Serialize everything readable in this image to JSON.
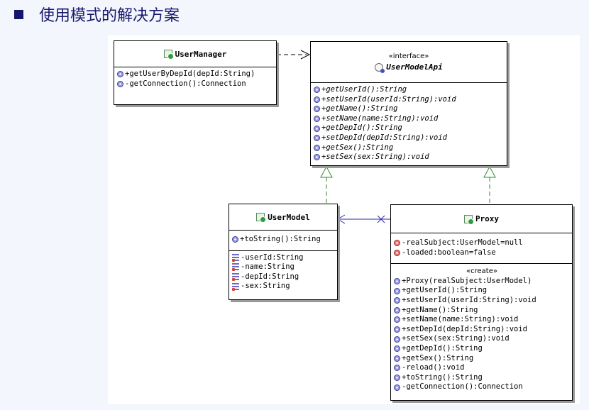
{
  "slide": {
    "title": "使用模式的解决方案"
  },
  "classes": {
    "user_manager": {
      "name": "UserManager",
      "methods": [
        {
          "vis": "pub",
          "text": "+getUserByDepId(depId:String)"
        },
        {
          "vis": "pub",
          "text": "-getConnection():Connection"
        }
      ]
    },
    "user_model_api": {
      "stereotype": "«interface»",
      "name": "UserModelApi",
      "methods": [
        {
          "vis": "pub",
          "text": "+getUserId():String"
        },
        {
          "vis": "pub",
          "text": "+setUserId(userId:String):void"
        },
        {
          "vis": "pub",
          "text": "+getName():String"
        },
        {
          "vis": "pub",
          "text": "+setName(name:String):void"
        },
        {
          "vis": "pub",
          "text": "+getDepId():String"
        },
        {
          "vis": "pub",
          "text": "+setDepId(depId:String):void"
        },
        {
          "vis": "pub",
          "text": "+getSex():String"
        },
        {
          "vis": "pub",
          "text": "+setSex(sex:String):void"
        }
      ]
    },
    "user_model": {
      "name": "UserModel",
      "methods": [
        {
          "vis": "pub",
          "text": "+toString():String"
        }
      ],
      "fields": [
        {
          "vis": "fld",
          "text": "-userId:String"
        },
        {
          "vis": "fld",
          "text": "-name:String"
        },
        {
          "vis": "fld",
          "text": "-depId:String"
        },
        {
          "vis": "fld",
          "text": "-sex:String"
        }
      ]
    },
    "proxy": {
      "name": "Proxy",
      "fields": [
        {
          "vis": "priv",
          "text": "-realSubject:UserModel=null"
        },
        {
          "vis": "priv",
          "text": "-loaded:boolean=false"
        }
      ],
      "create_label": "«create»",
      "methods": [
        {
          "vis": "pub",
          "text": "+Proxy(realSubject:UserModel)"
        },
        {
          "vis": "pub",
          "text": "+getUserId():String"
        },
        {
          "vis": "pub",
          "text": "+setUserId(userId:String):void"
        },
        {
          "vis": "pub",
          "text": "+getName():String"
        },
        {
          "vis": "pub",
          "text": "+setName(name:String):void"
        },
        {
          "vis": "pub",
          "text": "+setDepId(depId:String):void"
        },
        {
          "vis": "pub",
          "text": "+setSex(sex:String):void"
        },
        {
          "vis": "pub",
          "text": "+getDepId():String"
        },
        {
          "vis": "pub",
          "text": "+getSex():String"
        },
        {
          "vis": "pub",
          "text": "-reload():void"
        },
        {
          "vis": "pub",
          "text": "+toString():String"
        },
        {
          "vis": "pub",
          "text": "-getConnection():Connection"
        }
      ]
    }
  },
  "relations": [
    {
      "from": "UserManager",
      "to": "UserModelApi",
      "kind": "dependency"
    },
    {
      "from": "UserModel",
      "to": "UserModelApi",
      "kind": "realization"
    },
    {
      "from": "Proxy",
      "to": "UserModelApi",
      "kind": "realization"
    },
    {
      "from": "Proxy",
      "to": "UserModel",
      "kind": "navigable-association"
    }
  ],
  "colors": {
    "title": "#1a1a6e",
    "association": "#2a2aa8",
    "realization": "#2e8a2e"
  }
}
